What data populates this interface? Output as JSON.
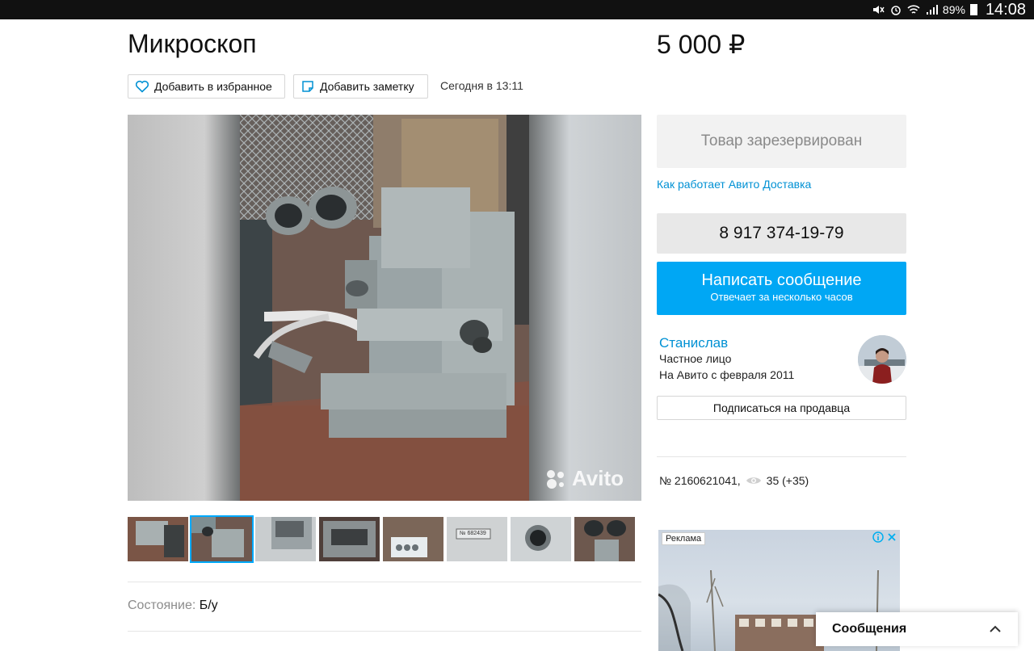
{
  "status_bar": {
    "battery": "89%",
    "time": "14:08"
  },
  "listing": {
    "title": "Микроскоп",
    "price": "5 000 ₽",
    "add_favorite_label": "Добавить в избранное",
    "add_note_label": "Добавить заметку",
    "posted": "Сегодня в 13:11",
    "watermark": "Avito",
    "condition_label": "Состояние:",
    "condition_value": "Б/у"
  },
  "sidebar": {
    "reserved_label": "Товар зарезервирован",
    "delivery_link": "Как работает Авито Доставка",
    "phone": "8 917 374-19-79",
    "message_button": "Написать сообщение",
    "message_sub": "Отвечает за несколько часов",
    "seller_name": "Станислав",
    "seller_type": "Частное лицо",
    "seller_since": "На Авито с февраля 2011",
    "subscribe_label": "Подписаться на продавца",
    "listing_number": "№ 2160621041,",
    "views": "35 (+35)"
  },
  "ad": {
    "label": "Реклама"
  },
  "messages_panel": {
    "title": "Сообщения"
  },
  "thumbnails": {
    "count": 8,
    "active_index": 1,
    "thumb_5_text": "№ 682439"
  }
}
